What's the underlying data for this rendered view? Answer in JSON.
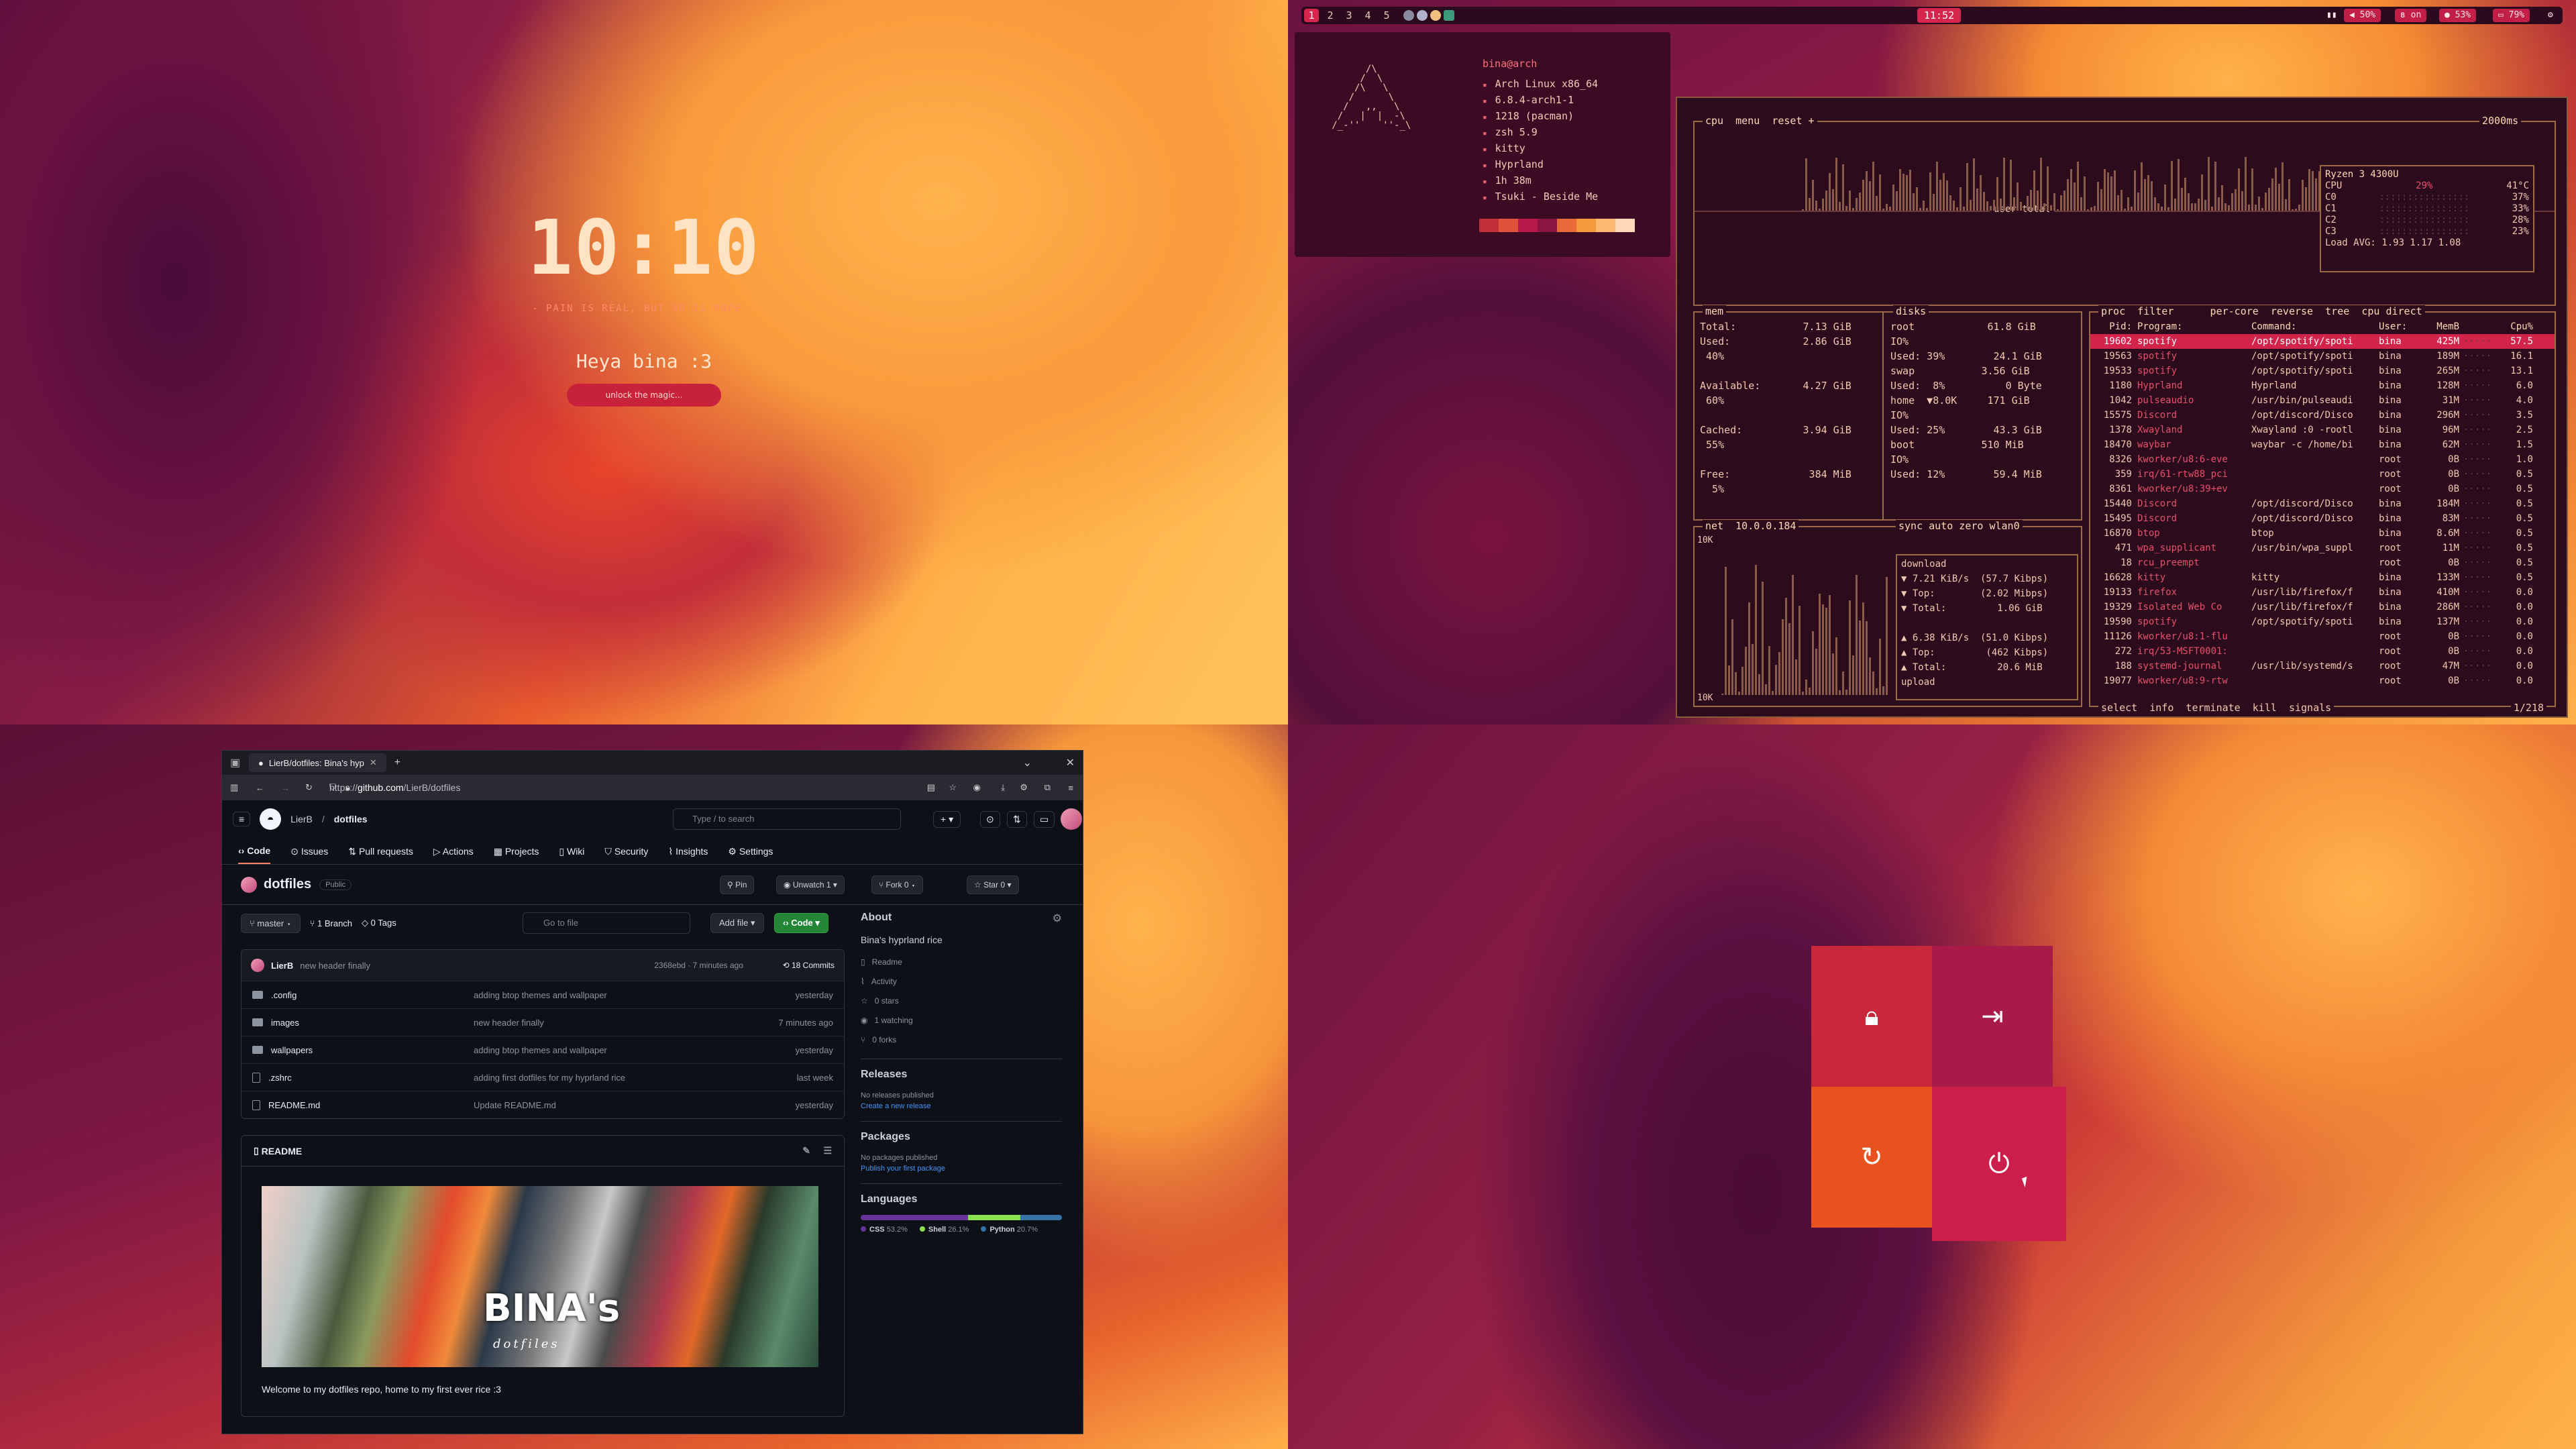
{
  "lockscreen": {
    "time": "10:10",
    "motto": "- PAIN IS REAL, BUT SO IS HOPE -",
    "greeting": "Heya bina :3",
    "unlock_label": "unlock the magic..."
  },
  "topbar": {
    "workspaces": [
      "1",
      "2",
      "3",
      "4",
      "5"
    ],
    "active_workspace": "1",
    "clock": "11:52",
    "chips": [
      {
        "icon": "chart-icon",
        "label": ""
      },
      {
        "icon": "volume-icon",
        "label": "50%"
      },
      {
        "icon": "bluetooth-icon",
        "label": "on"
      },
      {
        "icon": "mic-icon",
        "label": "53%"
      },
      {
        "icon": "battery-icon",
        "label": "79%"
      }
    ]
  },
  "fetch": {
    "user_host": "bina@arch",
    "rows": [
      "Arch Linux x86_64",
      "6.8.4-arch1-1",
      "1218 (pacman)",
      "zsh 5.9",
      "kitty",
      "Hyprland",
      "1h 38m",
      "Tsuki - Beside Me"
    ],
    "swatches": [
      "#c22e3a",
      "#e0523a",
      "#b8184a",
      "#8c1440",
      "#e86a3a",
      "#f59a3c",
      "#ffb870",
      "#ffd9b8"
    ]
  },
  "btop": {
    "cpu_title": "cpu  menu  reset +",
    "refresh": "2000ms",
    "graph_label": "user  total",
    "cpu_model": "Ryzen 3 4300U",
    "cores": [
      {
        "name": "CPU",
        "pct": "29%",
        "extra": "41°C"
      },
      {
        "name": "C0",
        "pct": "",
        "extra": "37%"
      },
      {
        "name": "C1",
        "pct": "",
        "extra": "33%"
      },
      {
        "name": "C2",
        "pct": "",
        "extra": "28%"
      },
      {
        "name": "C3",
        "pct": "",
        "extra": "23%"
      }
    ],
    "load_avg": "Load AVG:   1.93   1.17   1.08",
    "mem_lines": [
      "Total:           7.13 GiB",
      "Used:            2.86 GiB",
      " 40%",
      "",
      "Available:       4.27 GiB",
      " 60%",
      "",
      "Cached:          3.94 GiB",
      " 55%",
      "",
      "Free:             384 MiB",
      "  5%"
    ],
    "disk_lines": [
      "root            61.8 GiB",
      "IO%",
      "Used: 39%        24.1 GiB",
      "swap           3.56 GiB",
      "Used:  8%          0 Byte",
      "home  ▼8.0K     171 GiB",
      "IO%",
      "Used: 25%        43.3 GiB",
      "boot           510 MiB",
      "IO%",
      "Used: 12%        59.4 MiB"
    ],
    "net_title": "net  10.0.0.184",
    "net_lines": [
      "download",
      "▼ 7.21 KiB/s  (57.7 Kibps)",
      "▼ Top:        (2.02 Mibps)",
      "▼ Total:         1.06 GiB",
      "",
      "▲ 6.38 KiB/s  (51.0 Kibps)",
      "▲ Top:         (462 Kibps)",
      "▲ Total:         20.6 MiB",
      "upload"
    ],
    "net_scale": "10K",
    "proc_title": "proc  filter      per-core  reverse  tree  cpu direct",
    "proc_headers": [
      "Pid:",
      "Program:",
      "Command:",
      "User:",
      "MemB",
      "",
      "Cpu%"
    ],
    "procs": [
      {
        "pid": "19602",
        "prog": "spotify",
        "cmd": "/opt/spotify/spoti",
        "user": "bina",
        "mem": "425M",
        "cpu": "57.5"
      },
      {
        "pid": "19563",
        "prog": "spotify",
        "cmd": "/opt/spotify/spoti",
        "user": "bina",
        "mem": "189M",
        "cpu": "16.1"
      },
      {
        "pid": "19533",
        "prog": "spotify",
        "cmd": "/opt/spotify/spoti",
        "user": "bina",
        "mem": "265M",
        "cpu": "13.1"
      },
      {
        "pid": "1180",
        "prog": "Hyprland",
        "cmd": "Hyprland",
        "user": "bina",
        "mem": "128M",
        "cpu": "6.0"
      },
      {
        "pid": "1042",
        "prog": "pulseaudio",
        "cmd": "/usr/bin/pulseaudi",
        "user": "bina",
        "mem": "31M",
        "cpu": "4.0"
      },
      {
        "pid": "15575",
        "prog": "Discord",
        "cmd": "/opt/discord/Disco",
        "user": "bina",
        "mem": "296M",
        "cpu": "3.5"
      },
      {
        "pid": "1378",
        "prog": "Xwayland",
        "cmd": "Xwayland :0 -rootl",
        "user": "bina",
        "mem": "96M",
        "cpu": "2.5"
      },
      {
        "pid": "18470",
        "prog": "waybar",
        "cmd": "waybar -c /home/bi",
        "user": "bina",
        "mem": "62M",
        "cpu": "1.5"
      },
      {
        "pid": "8326",
        "prog": "kworker/u8:6-eve",
        "cmd": "",
        "user": "root",
        "mem": "0B",
        "cpu": "1.0"
      },
      {
        "pid": "359",
        "prog": "irq/61-rtw88_pci",
        "cmd": "",
        "user": "root",
        "mem": "0B",
        "cpu": "0.5"
      },
      {
        "pid": "8361",
        "prog": "kworker/u8:39+ev",
        "cmd": "",
        "user": "root",
        "mem": "0B",
        "cpu": "0.5"
      },
      {
        "pid": "15440",
        "prog": "Discord",
        "cmd": "/opt/discord/Disco",
        "user": "bina",
        "mem": "184M",
        "cpu": "0.5"
      },
      {
        "pid": "15495",
        "prog": "Discord",
        "cmd": "/opt/discord/Disco",
        "user": "bina",
        "mem": "83M",
        "cpu": "0.5"
      },
      {
        "pid": "16870",
        "prog": "btop",
        "cmd": "btop",
        "user": "bina",
        "mem": "8.6M",
        "cpu": "0.5"
      },
      {
        "pid": "471",
        "prog": "wpa_supplicant",
        "cmd": "/usr/bin/wpa_suppl",
        "user": "root",
        "mem": "11M",
        "cpu": "0.5"
      },
      {
        "pid": "18",
        "prog": "rcu_preempt",
        "cmd": "",
        "user": "root",
        "mem": "0B",
        "cpu": "0.5"
      },
      {
        "pid": "16628",
        "prog": "kitty",
        "cmd": "kitty",
        "user": "bina",
        "mem": "133M",
        "cpu": "0.5"
      },
      {
        "pid": "19133",
        "prog": "firefox",
        "cmd": "/usr/lib/firefox/f",
        "user": "bina",
        "mem": "410M",
        "cpu": "0.0"
      },
      {
        "pid": "19329",
        "prog": "Isolated Web Co",
        "cmd": "/usr/lib/firefox/f",
        "user": "bina",
        "mem": "286M",
        "cpu": "0.0"
      },
      {
        "pid": "19590",
        "prog": "spotify",
        "cmd": "/opt/spotify/spoti",
        "user": "bina",
        "mem": "137M",
        "cpu": "0.0"
      },
      {
        "pid": "11126",
        "prog": "kworker/u8:1-flu",
        "cmd": "",
        "user": "root",
        "mem": "0B",
        "cpu": "0.0"
      },
      {
        "pid": "272",
        "prog": "irq/53-MSFT0001:",
        "cmd": "",
        "user": "root",
        "mem": "0B",
        "cpu": "0.0"
      },
      {
        "pid": "188",
        "prog": "systemd-journal",
        "cmd": "/usr/lib/systemd/s",
        "user": "root",
        "mem": "47M",
        "cpu": "0.0"
      },
      {
        "pid": "19077",
        "prog": "kworker/u8:9-rtw",
        "cmd": "",
        "user": "root",
        "mem": "0B",
        "cpu": "0.0"
      }
    ],
    "proc_footer": "select  info  terminate  kill  signals",
    "proc_count": "1/218"
  },
  "browser": {
    "tab_title": "LierB/dotfiles: Bina's hyp",
    "url_prefix": "https://",
    "url_host": "github.com",
    "url_path": "/LierB/dotfiles",
    "owner": "LierB",
    "repo": "dotfiles",
    "search_placeholder": "Type / to search",
    "nav": [
      "Code",
      "Issues",
      "Pull requests",
      "Actions",
      "Projects",
      "Wiki",
      "Security",
      "Insights",
      "Settings"
    ],
    "visibility": "Public",
    "pin_label": "Pin",
    "unwatch_label": "Unwatch",
    "unwatch_count": "1",
    "fork_label": "Fork",
    "fork_count": "0",
    "star_label": "Star",
    "star_count": "0",
    "branch": "master",
    "branches": "1 Branch",
    "tags": "0 Tags",
    "goto_placeholder": "Go to file",
    "add_file": "Add file",
    "code_btn": "Code",
    "commit_user": "LierB",
    "commit_msg": "new header finally",
    "commit_meta": "2368ebd · 7 minutes ago",
    "commits": "18 Commits",
    "files": [
      {
        "type": "folder",
        "name": ".config",
        "msg": "adding btop themes and wallpaper",
        "time": "yesterday"
      },
      {
        "type": "folder",
        "name": "images",
        "msg": "new header finally",
        "time": "7 minutes ago"
      },
      {
        "type": "folder",
        "name": "wallpapers",
        "msg": "adding btop themes and wallpaper",
        "time": "yesterday"
      },
      {
        "type": "file",
        "name": ".zshrc",
        "msg": "adding first dotfiles for my hyprland rice",
        "time": "last week"
      },
      {
        "type": "file",
        "name": "README.md",
        "msg": "Update README.md",
        "time": "yesterday"
      }
    ],
    "readme_tab": "README",
    "banner_title": "BINA's",
    "banner_sub": "dotfiles",
    "welcome": "Welcome to my dotfiles repo, home to my first ever rice :3",
    "about_title": "About",
    "about_desc": "Bina's hyprland rice",
    "about_items": [
      "Readme",
      "Activity",
      "0 stars",
      "1 watching",
      "0 forks"
    ],
    "releases_title": "Releases",
    "releases_none": "No releases published",
    "releases_link": "Create a new release",
    "packages_title": "Packages",
    "packages_none": "No packages published",
    "packages_link": "Publish your first package",
    "languages_title": "Languages",
    "languages": [
      {
        "name": "CSS",
        "pct": "53.2%",
        "color": "#663399",
        "value": 53.2
      },
      {
        "name": "Shell",
        "pct": "26.1%",
        "color": "#89e051",
        "value": 26.1
      },
      {
        "name": "Python",
        "pct": "20.7%",
        "color": "#3572A5",
        "value": 20.7
      }
    ]
  },
  "power_menu": {
    "items": [
      "lock-icon",
      "logout-icon",
      "reboot-icon",
      "power-icon"
    ],
    "colors": [
      "#c8283a",
      "#a81a48",
      "#e8521e",
      "#cc1e4a"
    ]
  }
}
